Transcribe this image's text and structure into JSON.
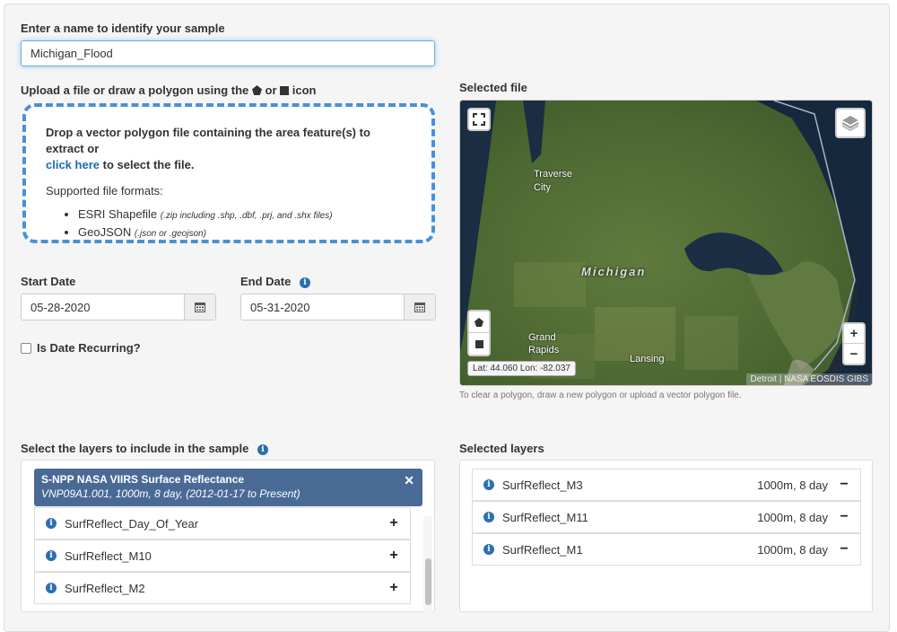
{
  "name_section": {
    "label": "Enter a name to identify your sample",
    "value": "Michigan_Flood"
  },
  "upload_section": {
    "label_prefix": "Upload a file or draw a polygon using the",
    "label_or": "or",
    "label_suffix": "icon",
    "drop_text": "Drop a vector polygon file containing the area feature(s) to extract or",
    "click_link": "click here",
    "drop_text_end": "to select the file.",
    "formats_label": "Supported file formats:",
    "formats": [
      {
        "name": "ESRI Shapefile",
        "note": "(.zip including .shp, .dbf, .prj, and .shx files)"
      },
      {
        "name": "GeoJSON",
        "note": "(.json or .geojson)"
      }
    ]
  },
  "dates": {
    "start_label": "Start Date",
    "start_value": "05-28-2020",
    "end_label": "End Date",
    "end_value": "05-31-2020",
    "recurring_label": "Is Date Recurring?"
  },
  "map": {
    "label": "Selected file",
    "place_labels": [
      "Traverse",
      "City",
      "Michigan",
      "Grand",
      "Rapids",
      "Lansing",
      "Detroit"
    ],
    "coords": "Lat: 44.060 Lon: -82.037",
    "attribution": "NASA EOSDIS GIBS",
    "zoom_in": "+",
    "zoom_out": "−",
    "hint": "To clear a polygon, draw a new polygon or upload a vector polygon file."
  },
  "layers": {
    "label": "Select the layers to include in the sample",
    "product_title": "S-NPP NASA VIIRS Surface Reflectance",
    "product_subtitle": "VNP09A1.001, 1000m, 8 day, (2012-01-17 to Present)",
    "available": [
      {
        "name": "SurfReflect_Day_Of_Year"
      },
      {
        "name": "SurfReflect_M10"
      },
      {
        "name": "SurfReflect_M2"
      }
    ]
  },
  "selected_layers": {
    "label": "Selected layers",
    "items": [
      {
        "name": "SurfReflect_M3",
        "res": "1000m, 8 day"
      },
      {
        "name": "SurfReflect_M11",
        "res": "1000m, 8 day"
      },
      {
        "name": "SurfReflect_M1",
        "res": "1000m, 8 day"
      }
    ]
  },
  "colors": {
    "accent": "#4a90d9",
    "link": "#1f6cb5",
    "product_header": "#4a6a96",
    "info_icon": "#2c6fb3"
  }
}
